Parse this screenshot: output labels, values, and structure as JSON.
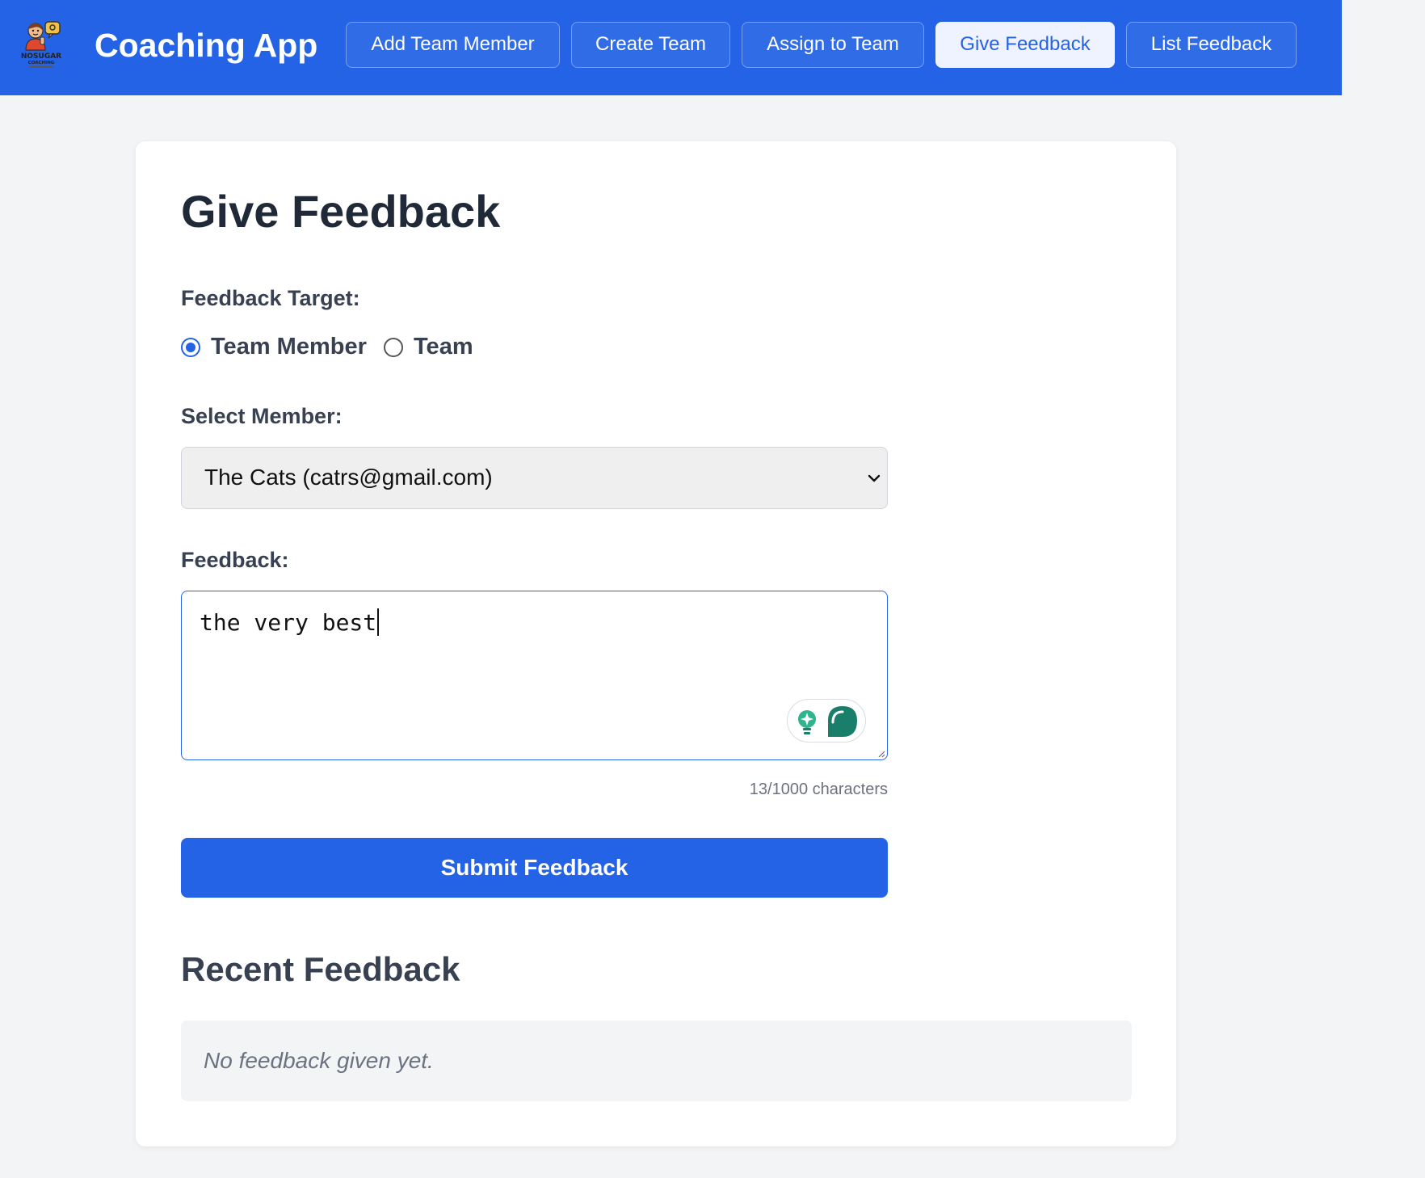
{
  "app": {
    "title": "Coaching App",
    "logo_text": "NOSUGAR COACHING"
  },
  "nav": {
    "items": [
      {
        "label": "Add Team Member",
        "active": false
      },
      {
        "label": "Create Team",
        "active": false
      },
      {
        "label": "Assign to Team",
        "active": false
      },
      {
        "label": "Give Feedback",
        "active": true
      },
      {
        "label": "List Feedback",
        "active": false
      }
    ]
  },
  "page": {
    "title": "Give Feedback"
  },
  "form": {
    "target_label": "Feedback Target:",
    "target_options": [
      {
        "label": "Team Member",
        "checked": true
      },
      {
        "label": "Team",
        "checked": false
      }
    ],
    "member_label": "Select Member:",
    "member_selected": "The Cats (catrs@gmail.com)",
    "feedback_label": "Feedback:",
    "feedback_value": "the very best",
    "char_count": "13/1000 characters",
    "submit_label": "Submit Feedback"
  },
  "recent": {
    "title": "Recent Feedback",
    "empty_text": "No feedback given yet."
  },
  "colors": {
    "primary": "#2563e6",
    "background": "#f3f4f6",
    "widget_accent": "#1a7f6a"
  },
  "icons": {
    "logo": "coach-mascot-logo",
    "select_arrow": "chevron-down-icon",
    "assistant": "writing-assistant-icon"
  }
}
